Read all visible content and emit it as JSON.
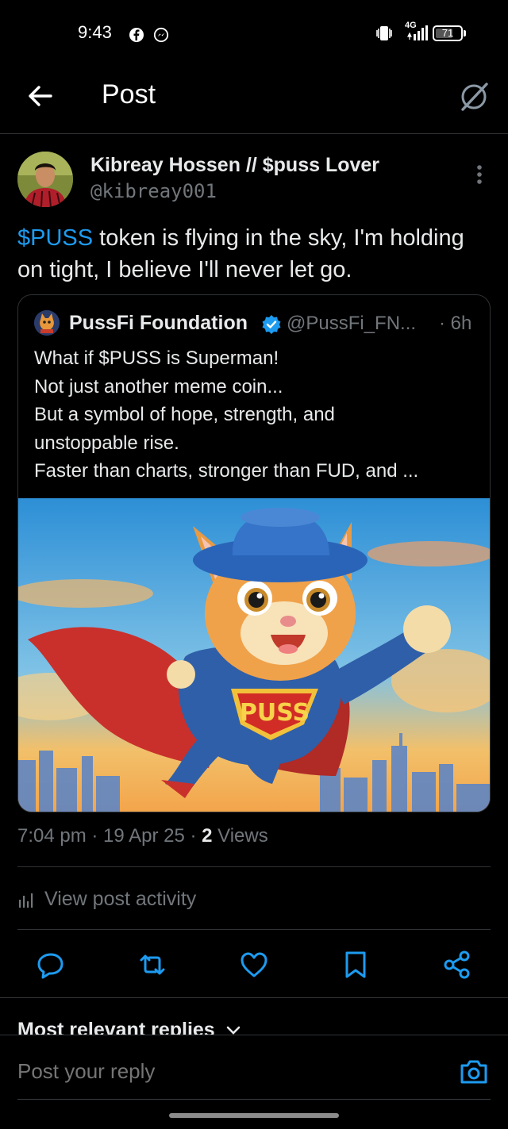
{
  "status_bar": {
    "time": "9:43",
    "network": "4G",
    "battery": "71",
    "battery_fraction": 0.71
  },
  "header": {
    "title": "Post"
  },
  "post": {
    "author_name": "Kibreay Hossen // $puss Lover",
    "author_handle": "@kibreay001",
    "text_cashtag": "$PUSS",
    "text_rest": " token is flying in the sky, I'm holding on tight, I believe I'll never let go.",
    "quoted": {
      "name": "PussFi Foundation",
      "handle": "@PussFi_FN...",
      "time": "· 6h",
      "lines": [
        "What if $PUSS is Superman!",
        "Not just another meme coin...",
        "But a symbol of hope, strength, and",
        "unstoppable rise.",
        "Faster than charts, stronger than FUD, and ..."
      ],
      "image_text": "PUSS"
    },
    "meta_time": "7:04 pm · 19 Apr 25 · ",
    "views_count": "2",
    "views_label": " Views"
  },
  "activity": {
    "label": "View post activity"
  },
  "replies": {
    "sort_label": "Most relevant replies",
    "input_placeholder": "Post your reply"
  },
  "colors": {
    "accent": "#1d9bf0",
    "background": "#000000",
    "muted_text": "#71767b",
    "divider": "#2f3336"
  },
  "icons": {
    "back": "arrow-left-icon",
    "grok": "grok-icon",
    "more": "more-vertical-icon",
    "verified": "verified-badge-icon",
    "reply": "reply-icon",
    "repost": "repost-icon",
    "like": "heart-icon",
    "bookmark": "bookmark-icon",
    "share": "share-icon",
    "camera": "camera-icon",
    "activity": "bar-chart-icon"
  }
}
